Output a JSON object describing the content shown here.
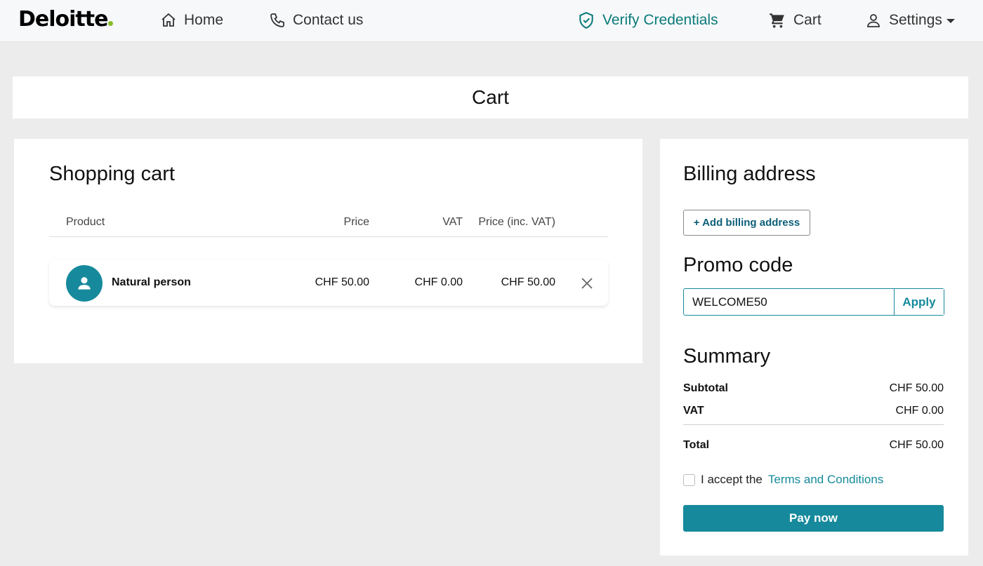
{
  "nav": {
    "logo_text": "Deloitte",
    "home": "Home",
    "contact": "Contact us",
    "verify": "Verify Credentials",
    "cart": "Cart",
    "settings": "Settings"
  },
  "page": {
    "title": "Cart"
  },
  "cart": {
    "heading": "Shopping cart",
    "columns": {
      "product": "Product",
      "price": "Price",
      "vat": "VAT",
      "price_inc": "Price (inc. VAT)"
    },
    "items": [
      {
        "name": "Natural person",
        "price": "CHF 50.00",
        "vat": "CHF 0.00",
        "price_inc": "CHF 50.00"
      }
    ]
  },
  "billing": {
    "heading": "Billing address",
    "add_label": "+ Add billing address"
  },
  "promo": {
    "heading": "Promo code",
    "value": "WELCOME50",
    "apply_label": "Apply"
  },
  "summary": {
    "heading": "Summary",
    "subtotal_label": "Subtotal",
    "subtotal": "CHF 50.00",
    "vat_label": "VAT",
    "vat": "CHF 0.00",
    "total_label": "Total",
    "total": "CHF 50.00"
  },
  "terms": {
    "prefix": "I accept the",
    "link": "Terms and Conditions",
    "checked": false
  },
  "pay_label": "Pay now",
  "colors": {
    "accent": "#168a9c",
    "brand_dot": "#86bc25",
    "verify": "#0b7a79"
  }
}
